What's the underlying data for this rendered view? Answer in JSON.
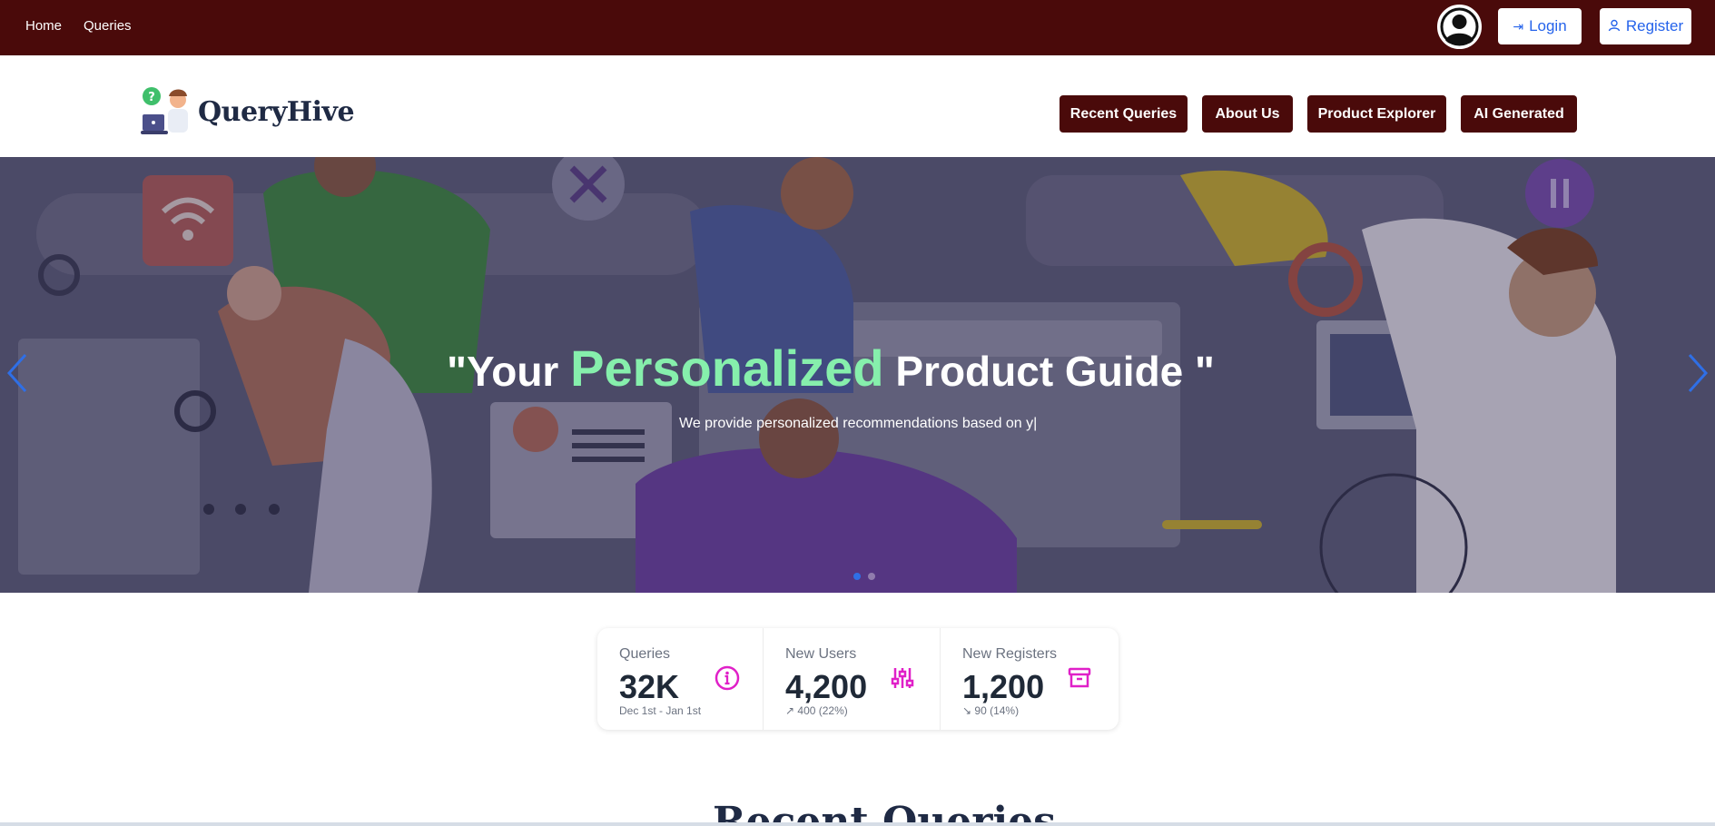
{
  "topbar": {
    "nav": [
      {
        "label": "Home"
      },
      {
        "label": "Queries"
      }
    ],
    "login_label": "Login",
    "register_label": "Register"
  },
  "header": {
    "brand": "QueryHive",
    "nav": [
      {
        "label": "Recent Queries"
      },
      {
        "label": "About Us"
      },
      {
        "label": "Product Explorer"
      },
      {
        "label": "AI Generated"
      }
    ]
  },
  "hero": {
    "title_prefix": "\"Your ",
    "title_highlight": "Personalized",
    "title_suffix": " Product Guide \"",
    "subtitle": "We provide personalized recommendations based on y|",
    "prev_arrow": "‹",
    "next_arrow": "›",
    "active_slide": 1,
    "slide_count": 2
  },
  "stats": [
    {
      "label": "Queries",
      "value": "32K",
      "note": "Dec 1st - Jan 1st",
      "icon": "info-icon"
    },
    {
      "label": "New Users",
      "value": "4,200",
      "note": "↗ 400 (22%)",
      "icon": "sliders-icon"
    },
    {
      "label": "New Registers",
      "value": "1,200",
      "note": "↘ 90 (14%)",
      "icon": "archive-icon"
    }
  ],
  "section_peek": "Recent Queries",
  "colors": {
    "brand_dark": "#4a0a0a",
    "accent_blue": "#2563eb",
    "highlight_green": "#86efac",
    "icon_magenta": "#e020c8"
  }
}
